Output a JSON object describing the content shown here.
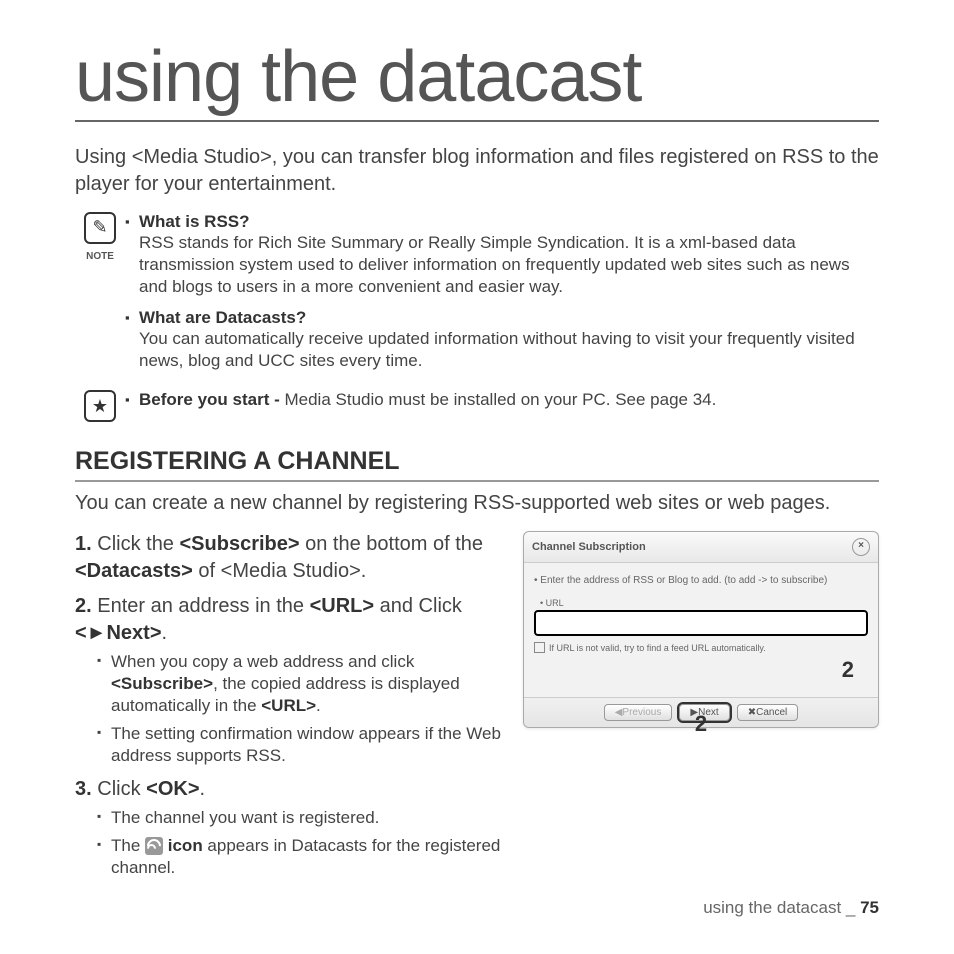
{
  "title": "using the datacast",
  "intro": "Using <Media Studio>, you can transfer blog information and files registered on RSS to the player for your entertainment.",
  "note_label": "NOTE",
  "notes": [
    {
      "heading": "What is RSS?",
      "text": "RSS stands for Rich Site Summary or Really Simple Syndication. It is a xml-based data transmission system used to deliver information on frequently updated web sites such as news and blogs to users in a more convenient and easier way."
    },
    {
      "heading": "What are Datacasts?",
      "text": "You can automatically receive updated information without having to visit your frequently visited news, blog and UCC sites every time."
    }
  ],
  "before_start_label": "Before you start - ",
  "before_start_text": "Media Studio must be installed on your PC. See page 34.",
  "section_title": "REGISTERING A CHANNEL",
  "section_intro": "You can create a new channel by registering RSS-supported web sites or web pages.",
  "steps": {
    "s1": {
      "num": "1.",
      "pre": " Click the ",
      "b1": "<Subscribe>",
      "mid": " on the bottom of the ",
      "b2": "<Datacasts>",
      "post": " of <Media Studio>."
    },
    "s2": {
      "num": "2.",
      "pre": " Enter an address in the ",
      "b1": "<URL>",
      "mid": " and Click ",
      "b2": "<►Next>",
      "post": ".",
      "sub1_a": "When you copy a web address and click ",
      "sub1_b": "<Subscribe>",
      "sub1_c": ", the copied address is displayed automatically in the ",
      "sub1_d": "<URL>",
      "sub1_e": ".",
      "sub2": "The setting confirmation window appears if the Web address supports RSS."
    },
    "s3": {
      "num": "3.",
      "pre": " Click ",
      "b1": "<OK>",
      "post": ".",
      "sub1": "The channel you want is registered.",
      "sub2_a": "The ",
      "sub2_b": " icon",
      "sub2_c": " appears in Datacasts for the registered channel."
    }
  },
  "dialog": {
    "title": "Channel Subscription",
    "instruction": "• Enter the address of RSS or Blog to add. (to add -> to subscribe)",
    "url_label": "• URL",
    "checkbox": "If URL is not valid, try to find a feed URL automatically.",
    "btn_prev": "◀Previous",
    "btn_next": "▶Next",
    "btn_cancel": "✖Cancel",
    "marker": "2"
  },
  "footer": {
    "text": "using the datacast _ ",
    "page": "75"
  }
}
